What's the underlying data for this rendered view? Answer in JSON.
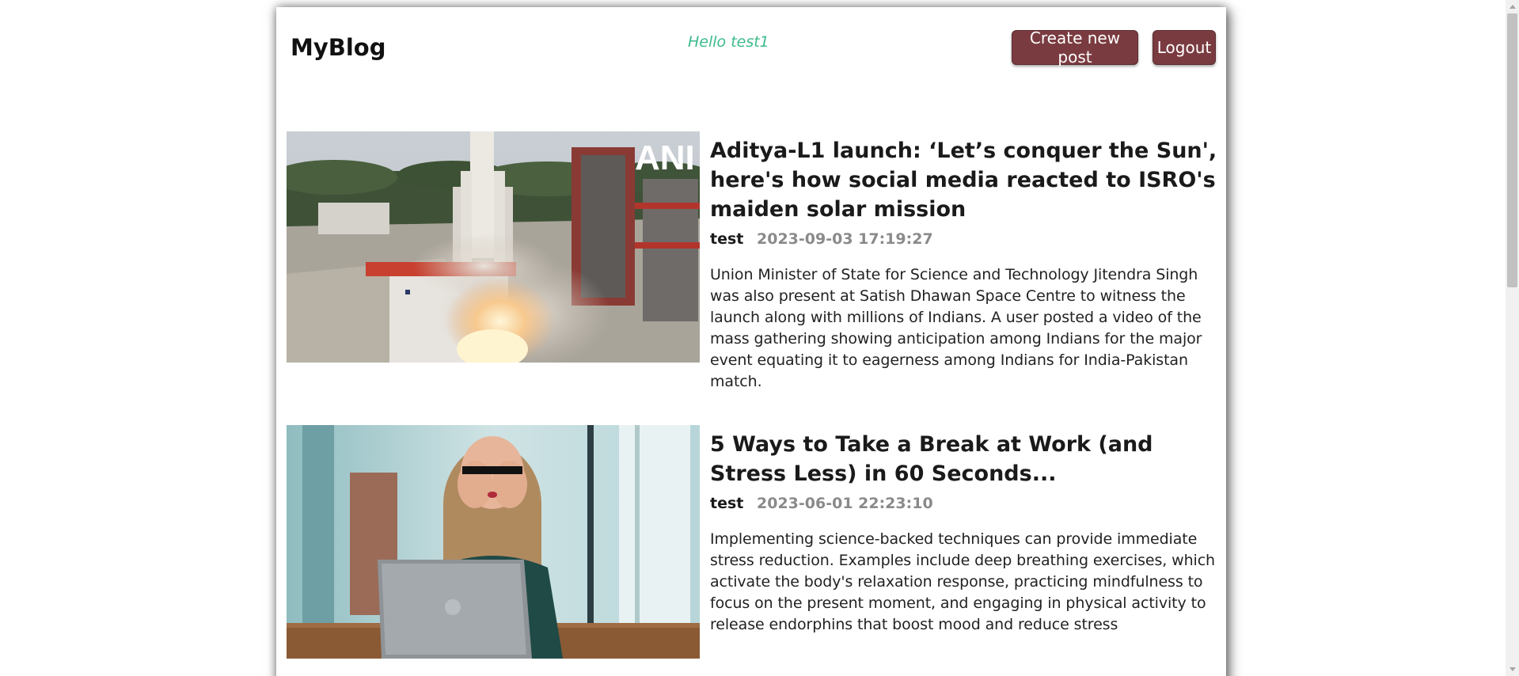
{
  "header": {
    "logo": "MyBlog",
    "greeting": "Hello test1",
    "create_label": "Create new post",
    "logout_label": "Logout"
  },
  "colors": {
    "button_bg": "#7a3b40",
    "greeting": "#3dbb8a",
    "date": "#8a8a8a"
  },
  "posts": [
    {
      "title": "Aditya-L1 launch: ‘Let’s conquer the Sun', here's how social media reacted to ISRO's maiden solar mission",
      "author": "test",
      "date": "2023-09-03 17:19:27",
      "summary": "Union Minister of State for Science and Technology Jitendra Singh was also present at Satish Dhawan Space Centre to witness the launch along with millions of Indians. A user posted a video of the mass gathering showing anticipation among Indians for the major event equating it to eagerness among Indians for India-Pakistan match.",
      "image_watermark": "ANI"
    },
    {
      "title": "5 Ways to Take a Break at Work (and Stress Less) in 60 Seconds...",
      "author": "test",
      "date": "2023-06-01 22:23:10",
      "summary": "Implementing science-backed techniques can provide immediate stress reduction. Examples include deep breathing exercises, which activate the body's relaxation response, practicing mindfulness to focus on the present moment, and engaging in physical activity to release endorphins that boost mood and reduce stress"
    }
  ]
}
